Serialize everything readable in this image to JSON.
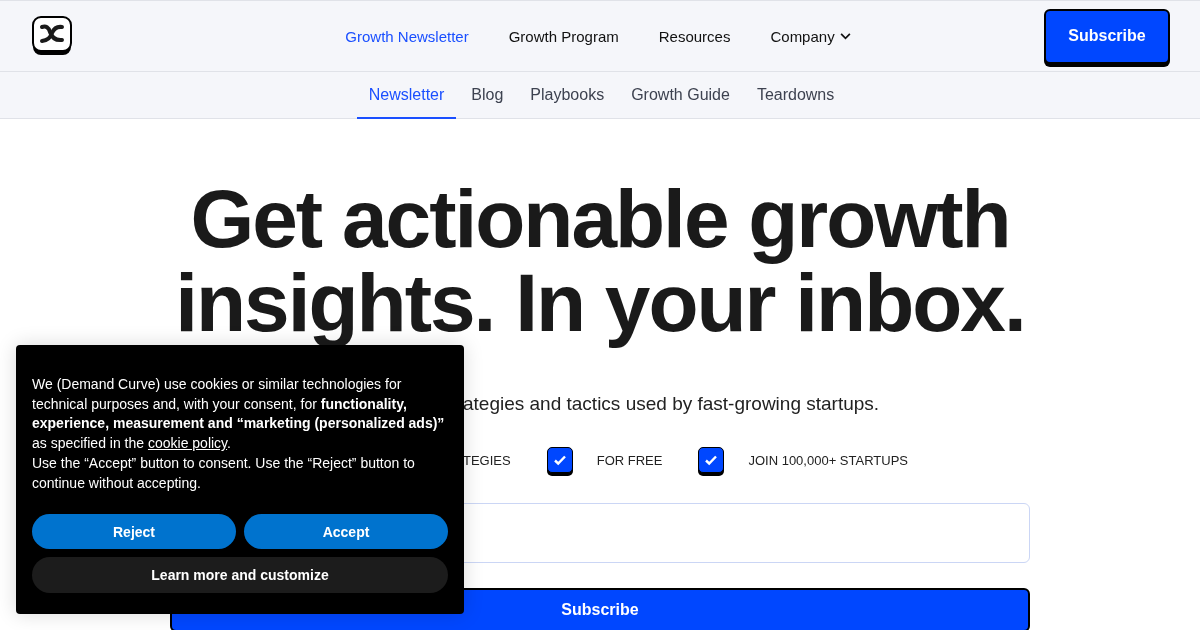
{
  "header": {
    "nav": [
      {
        "label": "Growth Newsletter",
        "selected": true,
        "kind": "link"
      },
      {
        "label": "Growth Program",
        "selected": false,
        "kind": "link"
      },
      {
        "label": "Resources",
        "selected": false,
        "kind": "link"
      },
      {
        "label": "Company",
        "selected": false,
        "kind": "dropdown"
      }
    ],
    "subscribe_button": "Subscribe"
  },
  "subnav": [
    {
      "label": "Newsletter",
      "selected": true
    },
    {
      "label": "Blog",
      "selected": false
    },
    {
      "label": "Playbooks",
      "selected": false
    },
    {
      "label": "Growth Guide",
      "selected": false
    },
    {
      "label": "Teardowns",
      "selected": false
    }
  ],
  "hero": {
    "headline": [
      "Get actionable growth",
      "insights. In your inbox."
    ],
    "subtitle": "ategies and tactics used by fast-growing startups.",
    "features": [
      {
        "label": "TEGIES"
      },
      {
        "label": "FOR FREE",
        "checked": true
      },
      {
        "label": "JOIN 100,000+ STARTUPS",
        "checked": true
      }
    ],
    "submit_button": "Subscribe"
  },
  "cookie_banner": {
    "text": "We (Demand Curve) use cookies or similar technologies for technical purposes and, with your consent, for **functionality, experience, measurement and “marketing (personalized ads)”** as specified in the",
    "link": "cookie policy",
    "text_after": ".",
    "text_2": "Use the “Accept” button to consent. Use the “Reject” button to continue without accepting.",
    "buttons": [
      {
        "label": "Reject",
        "kind": "primary"
      },
      {
        "label": "Accept",
        "kind": "primary"
      },
      {
        "label": "Learn more and customize",
        "kind": "secondary"
      }
    ]
  }
}
